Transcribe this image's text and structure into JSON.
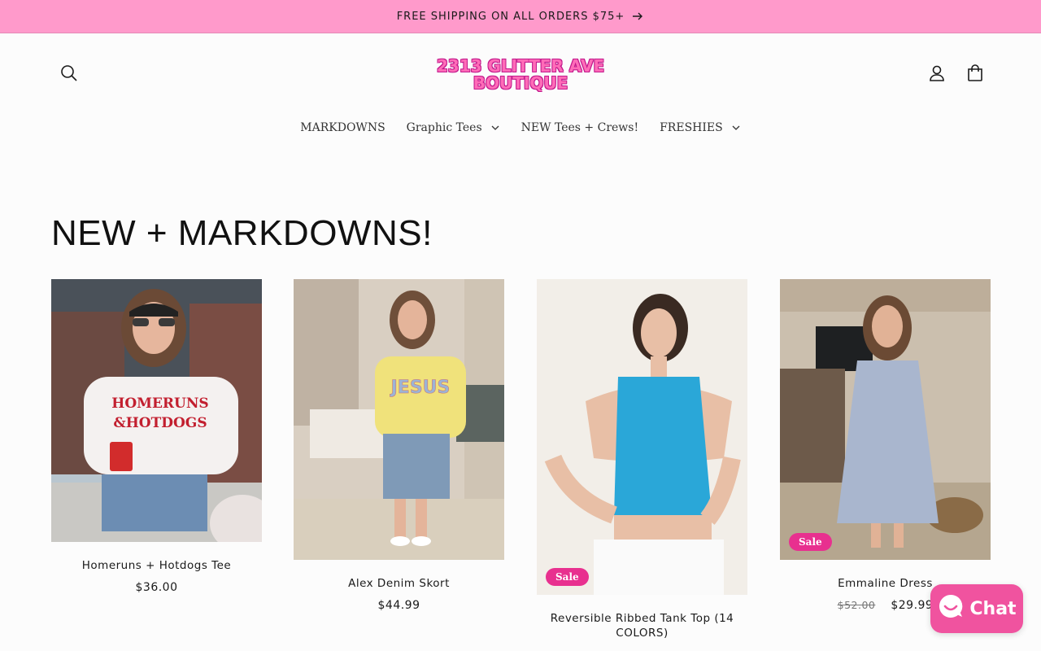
{
  "announcement": {
    "text": "FREE SHIPPING ON ALL ORDERS $75+"
  },
  "header": {
    "logo_line1": "2313 GLITTER AVE",
    "logo_line2": "BOUTIQUE"
  },
  "nav": {
    "items": [
      {
        "label": "MARKDOWNS",
        "has_dropdown": false
      },
      {
        "label": "Graphic Tees",
        "has_dropdown": true
      },
      {
        "label": "NEW Tees + Crews!",
        "has_dropdown": false
      },
      {
        "label": "FRESHIES",
        "has_dropdown": true
      }
    ]
  },
  "section": {
    "title": "NEW + MARKDOWNS!"
  },
  "products": [
    {
      "title": "Homeruns + Hotdogs Tee",
      "price": "$36.00",
      "old_price": "",
      "sale": false,
      "shirt_text_1": "HOMERUNS",
      "shirt_text_2": "&HOTDOGS"
    },
    {
      "title": "Alex Denim Skort",
      "price": "$44.99",
      "old_price": "",
      "sale": false,
      "shirt_text": "JESUS"
    },
    {
      "title": "Reversible Ribbed Tank Top (14 COLORS)",
      "price": "",
      "old_price": "",
      "sale": true,
      "badge": "Sale"
    },
    {
      "title": "Emmaline Dress",
      "price": "$29.99",
      "old_price": "$52.00",
      "sale": true,
      "badge": "Sale"
    }
  ],
  "chat": {
    "label": "Chat"
  },
  "colors": {
    "announcement_bg": "#ff9acb",
    "brand_pink": "#ff6cb8",
    "sale_badge": "#e8308f",
    "chat_button": "#f0539f"
  }
}
